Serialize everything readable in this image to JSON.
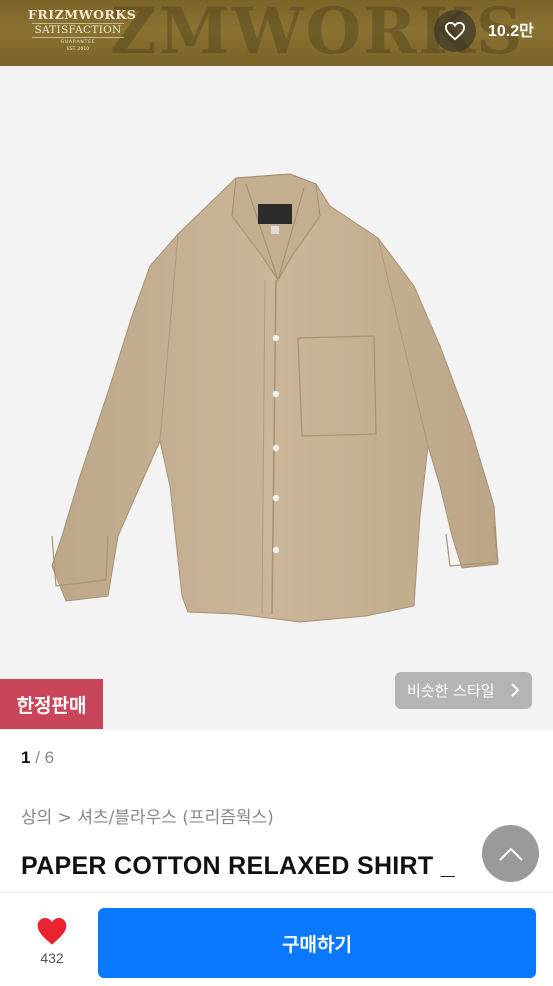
{
  "header": {
    "brand_line1": "FRIZMWORKS",
    "brand_line2": "SATISFACTION",
    "brand_line3": "GUARANTEE",
    "brand_line4": "EST. 2010",
    "background_text": "ZMWORKS",
    "like_count": "10.2만"
  },
  "gallery": {
    "limited_badge": "한정판매",
    "similar_style_label": "비슷한 스타일",
    "current_page": "1",
    "separator": " / ",
    "total_pages": "6"
  },
  "product": {
    "breadcrumb": "상의 > 셔츠/블라우스 (프리즘웍스)",
    "title": "PAPER COTTON RELAXED SHIRT _"
  },
  "bottom_bar": {
    "wish_count": "432",
    "buy_label": "구매하기"
  },
  "colors": {
    "banner": "#7b6429",
    "limited_badge": "#c8455a",
    "buy_button": "#0a78ff",
    "shirt": "#c9b397"
  },
  "icons": {
    "like": "heart-outline-icon",
    "wish": "heart-filled-icon",
    "similar": "chevron-right-icon",
    "scroll_top": "chevron-up-icon"
  }
}
